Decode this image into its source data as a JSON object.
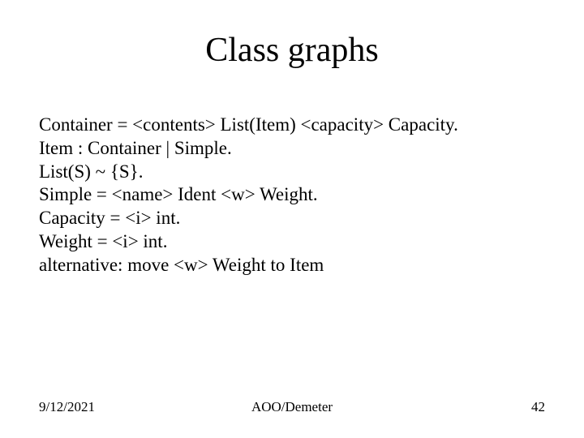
{
  "title": "Class graphs",
  "grammar": {
    "line1": "Container = <contents> List(Item) <capacity> Capacity.",
    "line2": "Item : Container | Simple.",
    "line3": "List(S) ~ {S}.",
    "line4": "Simple = <name> Ident <w> Weight.",
    "line5": "Capacity = <i> int.",
    "line6": "Weight = <i> int."
  },
  "alternative": "alternative: move <w> Weight to Item",
  "footer": {
    "date": "9/12/2021",
    "center": "AOO/Demeter",
    "page": "42"
  }
}
